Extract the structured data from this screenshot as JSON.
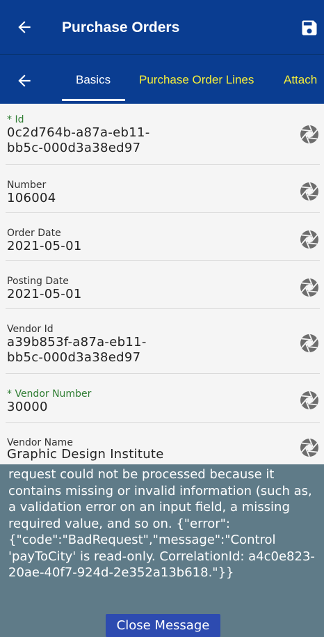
{
  "appbar": {
    "title": "Purchase Orders",
    "back_icon": "arrow-left-icon",
    "save_icon": "save-disk-icon"
  },
  "tabs": [
    {
      "label": "Basics",
      "active": true
    },
    {
      "label": "Purchase Order Lines",
      "active": false
    },
    {
      "label": "Attach",
      "active": false
    }
  ],
  "fields": [
    {
      "label": "* Id",
      "required": true,
      "value": "0c2d764b-a87a-eb11-\nbb5c-000d3a38ed97"
    },
    {
      "label": "Number",
      "required": false,
      "value": "106004"
    },
    {
      "label": "Order Date",
      "required": false,
      "value": "2021-05-01"
    },
    {
      "label": "Posting Date",
      "required": false,
      "value": "2021-05-01"
    },
    {
      "label": "Vendor Id",
      "required": false,
      "value": "a39b853f-a87a-eb11-\nbb5c-000d3a38ed97"
    },
    {
      "label": "* Vendor Number",
      "required": true,
      "value": "30000"
    },
    {
      "label": "Vendor Name",
      "required": false,
      "value": "Graphic Design Institute"
    }
  ],
  "field_icon": "camera-shutter-icon",
  "toast": {
    "message": "request could not be processed because it contains missing or invalid information (such as, a validation error on an input field, a missing required value, and so on. {\"error\": {\"code\":\"BadRequest\",\"message\":\"Control 'payToCity' is read-only.  CorrelationId: a4c0e823-20ae-40f7-924d-2e352a13b618.\"}}",
    "close_label": "Close Message"
  },
  "colors": {
    "primary": "#0a3d91",
    "tab_inactive": "#f5ee3a",
    "required_label": "#2e7d32",
    "toast_bg": "#5f7b88",
    "button": "#2d4bb0"
  }
}
